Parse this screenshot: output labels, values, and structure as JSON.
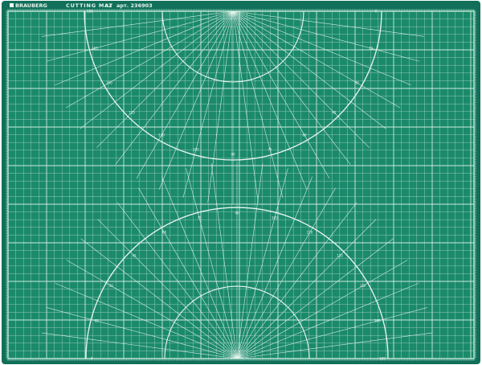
{
  "product": {
    "brand": "BRAUBERG",
    "name": "CUTTING MAT",
    "size": "A2",
    "article": "арт. 236903"
  },
  "colors": {
    "mat": "#1b8a6b",
    "border": "#12705a",
    "line": "#e6f4ee"
  },
  "protractor_labels": {
    "upper": [
      "0",
      "15",
      "30",
      "45",
      "60",
      "75",
      "90",
      "105",
      "120",
      "135",
      "150",
      "165",
      "180"
    ],
    "lower": [
      "0",
      "15",
      "30",
      "45",
      "60",
      "75",
      "90",
      "105",
      "120",
      "135",
      "150",
      "165",
      "180"
    ]
  }
}
